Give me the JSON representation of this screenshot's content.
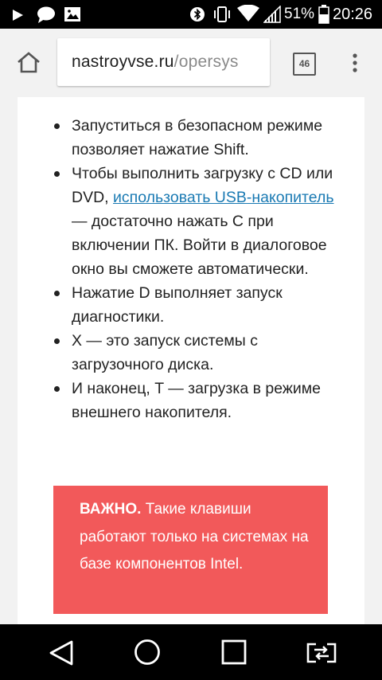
{
  "status_bar": {
    "battery_percent": "51%",
    "time": "20:26",
    "icons": [
      "play-icon",
      "chat-icon",
      "image-icon",
      "bluetooth-icon",
      "vibrate-icon",
      "wifi-icon",
      "signal-icon",
      "battery-icon"
    ]
  },
  "browser": {
    "url_domain": "nastroyvse.ru",
    "url_path": "/opersys",
    "tab_count": "46",
    "icons": [
      "home-icon",
      "tab-switcher-icon",
      "overflow-menu-icon"
    ]
  },
  "article": {
    "bullets": [
      {
        "text": "Запуститься в безопасном режиме позволяет нажатие Shift."
      },
      {
        "before": "Чтобы выполнить загрузку с CD или DVD, ",
        "link": "использовать USB-накопитель",
        "after": " — достаточно нажать C при включении ПК. Войти в диалоговое окно вы сможете автоматически."
      },
      {
        "text": "Нажатие D выполняет запуск диагностики."
      },
      {
        "text": "X — это запуск системы с загрузочного диска."
      },
      {
        "text": "И наконец, T — загрузка в режиме внешнего накопителя."
      }
    ],
    "alert_label": "ВАЖНО.",
    "alert_text": " Такие клавиши работают только на системах на базе компонентов Intel."
  },
  "nav_bar": {
    "icons": [
      "back-icon",
      "home-circle-icon",
      "recents-icon",
      "cast-screen-icon"
    ]
  },
  "colors": {
    "link": "#1a7ab3",
    "alert_bg": "#f2595a",
    "toolbar_bg": "#f2f2f2",
    "status_bg": "#000000"
  }
}
